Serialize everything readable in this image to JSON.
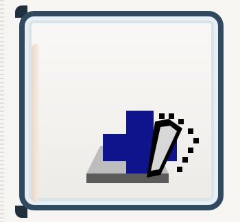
{
  "toolbar_button": {
    "kind": "add-row-or-insert",
    "icon_name": "plus-with-eraser-icon",
    "colors": {
      "frame": "#2F4A5F",
      "button_face": "#F3F1EE",
      "plus_blue": "#0D148C",
      "shadow_gray": "#BDBDBD",
      "dark_gray": "#5B5B5B",
      "black": "#000000"
    }
  }
}
